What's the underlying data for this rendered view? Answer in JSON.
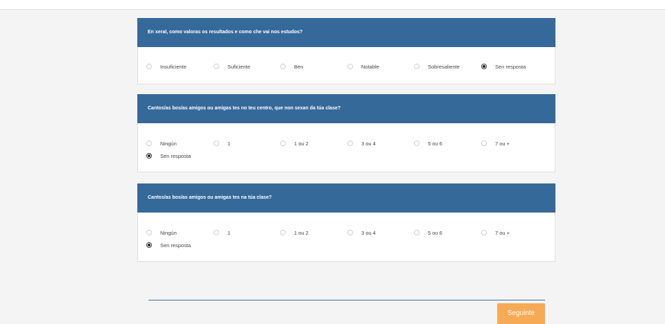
{
  "questions": [
    {
      "title": "En xeral, como valoras os resultados e como che vai nos estudos?",
      "options": [
        "Insuficiente",
        "Suficiente",
        "Ben",
        "Notable",
        "Sobresaliente",
        "Sen resposta"
      ],
      "selected": "Sen resposta"
    },
    {
      "title": "Cantos/as bos/as amigos ou amigas tes no teu centro, que non sexan da túa clase?",
      "options": [
        "Ningún",
        "1",
        "1 ou 2",
        "3 ou 4",
        "5 ou 6",
        "7 ou +",
        "Sen resposta"
      ],
      "selected": "Sen resposta"
    },
    {
      "title": "Cantos/as bos/as amigos ou amigas tes na túa clase?",
      "options": [
        "Ningún",
        "1",
        "1 ou 2",
        "3 ou 4",
        "5 ou 6",
        "7 ou +",
        "Sen resposta"
      ],
      "selected": "Sen resposta"
    }
  ],
  "next_label": "Seguinte"
}
